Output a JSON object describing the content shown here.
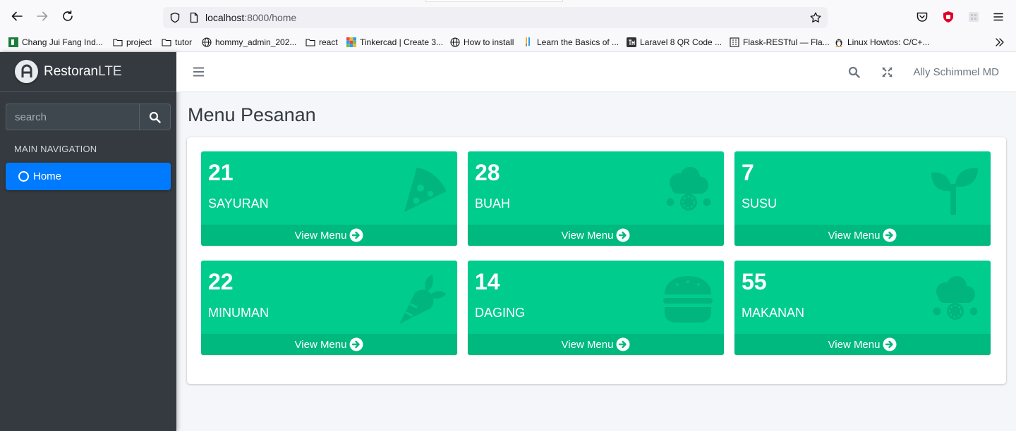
{
  "browser": {
    "url_host": "localhost",
    "url_rest": ":8000/home",
    "bookmarks": [
      {
        "label": "Chang Jui Fang Ind...",
        "icon": "green-square-icon"
      },
      {
        "label": "project",
        "icon": "folder-icon"
      },
      {
        "label": "tutor",
        "icon": "folder-icon"
      },
      {
        "label": "hommy_admin_202...",
        "icon": "globe-icon"
      },
      {
        "label": "react",
        "icon": "folder-icon"
      },
      {
        "label": "Tinkercad | Create 3...",
        "icon": "tinkercad-icon"
      },
      {
        "label": "How to install",
        "icon": "globe-icon"
      },
      {
        "label": "Learn the Basics of ...",
        "icon": "pencil-icon"
      },
      {
        "label": "Laravel 8 QR Code ...",
        "icon": "tm-icon"
      },
      {
        "label": "Flask-RESTful — Fla...",
        "icon": "building-icon"
      },
      {
        "label": "Linux Howtos: C/C+...",
        "icon": "tux-icon"
      }
    ]
  },
  "brand": {
    "name_bold": "Restoran",
    "name_light": "LTE"
  },
  "sidebar": {
    "search_placeholder": "search",
    "nav_header": "MAIN NAVIGATION",
    "home_label": "Home"
  },
  "topbar": {
    "user_name": "Ally Schimmel MD"
  },
  "page": {
    "title": "Menu Pesanan"
  },
  "colors": {
    "box_bg": "#00cc8e",
    "box_footer": "#00b97f",
    "accent": "#007bff"
  },
  "boxes": [
    {
      "count": "21",
      "category": "SAYURAN",
      "link": "View Menu",
      "icon": "pizza-slice-icon"
    },
    {
      "count": "28",
      "category": "BUAH",
      "link": "View Menu",
      "icon": "cloud-meatball-icon"
    },
    {
      "count": "7",
      "category": "SUSU",
      "link": "View Menu",
      "icon": "seedling-icon"
    },
    {
      "count": "22",
      "category": "MINUMAN",
      "link": "View Menu",
      "icon": "carrot-icon"
    },
    {
      "count": "14",
      "category": "DAGING",
      "link": "View Menu",
      "icon": "hamburger-icon"
    },
    {
      "count": "55",
      "category": "MAKANAN",
      "link": "View Menu",
      "icon": "cloud-meatball-icon"
    }
  ]
}
